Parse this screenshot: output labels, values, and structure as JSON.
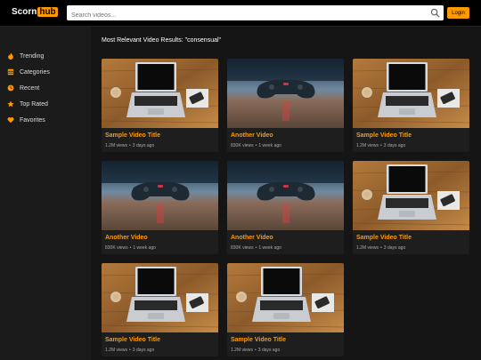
{
  "header": {
    "logo_left": "Scorn",
    "logo_right": "hub",
    "search_placeholder": "Search videos...",
    "login_label": "Login",
    "accent": "#ff9900"
  },
  "sidebar": {
    "items": [
      {
        "label": "Trending",
        "icon": "fire-icon"
      },
      {
        "label": "Categories",
        "icon": "grid-icon"
      },
      {
        "label": "Recent",
        "icon": "clock-icon"
      },
      {
        "label": "Top Rated",
        "icon": "star-icon"
      },
      {
        "label": "Favorites",
        "icon": "heart-icon"
      }
    ]
  },
  "results": {
    "title": "Most Relevant Video Results: \"consensual\"",
    "videos": [
      {
        "title": "Sample Video Title",
        "views": "1.2M views",
        "age": "3 days ago",
        "thumb": "laptop"
      },
      {
        "title": "Another Video",
        "views": "830K views",
        "age": "1 week ago",
        "thumb": "gamepad"
      },
      {
        "title": "Sample Video Title",
        "views": "1.2M views",
        "age": "3 days ago",
        "thumb": "laptop"
      },
      {
        "title": "Another Video",
        "views": "830K views",
        "age": "1 week ago",
        "thumb": "gamepad"
      },
      {
        "title": "Another Video",
        "views": "830K views",
        "age": "1 week ago",
        "thumb": "gamepad"
      },
      {
        "title": "Sample Video Title",
        "views": "1.2M views",
        "age": "3 days ago",
        "thumb": "laptop"
      },
      {
        "title": "Sample Video Title",
        "views": "1.2M views",
        "age": "3 days ago",
        "thumb": "laptop"
      },
      {
        "title": "Sample Video Title",
        "views": "1.2M views",
        "age": "3 days ago",
        "thumb": "laptop"
      }
    ]
  }
}
